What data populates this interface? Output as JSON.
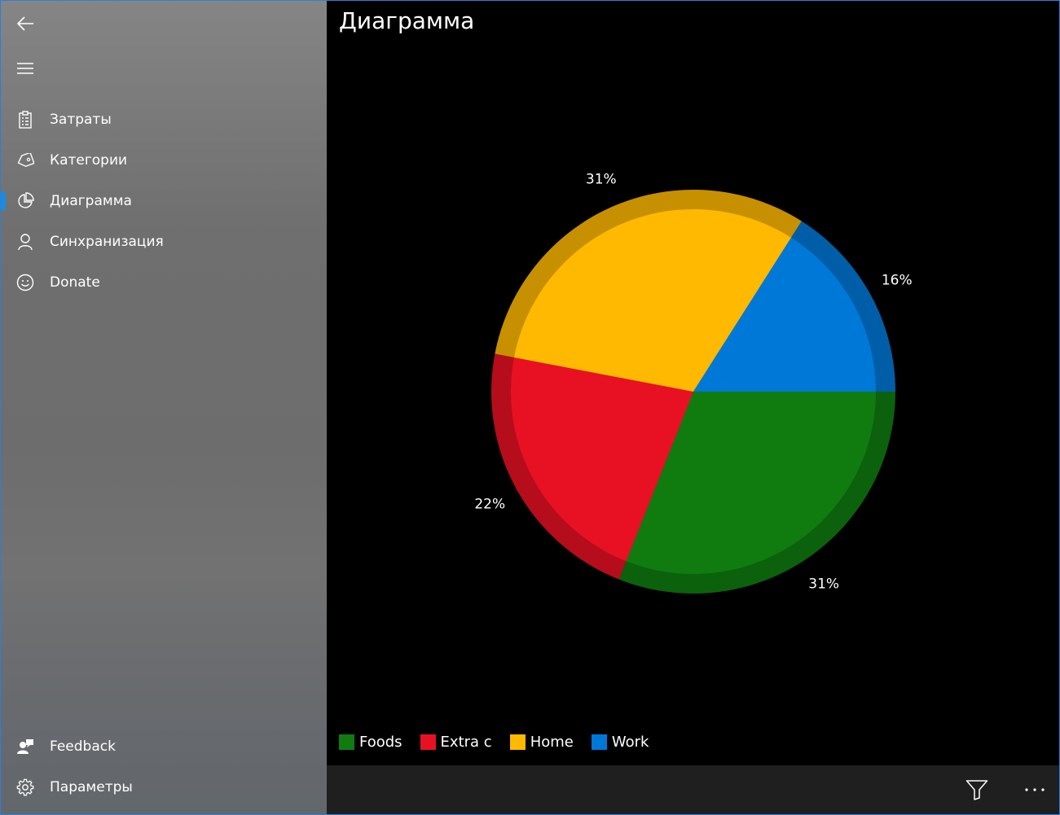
{
  "sidebar": {
    "items": [
      {
        "label": "Затраты",
        "icon": "clipboard-icon"
      },
      {
        "label": "Категории",
        "icon": "tag-icon"
      },
      {
        "label": "Диаграмма",
        "icon": "pie-chart-icon",
        "selected": true
      },
      {
        "label": "Синхранизация",
        "icon": "person-icon"
      },
      {
        "label": "Donate",
        "icon": "smiley-icon"
      }
    ],
    "footer": [
      {
        "label": "Feedback",
        "icon": "feedback-icon"
      },
      {
        "label": "Параметры",
        "icon": "gear-icon"
      }
    ]
  },
  "page": {
    "title": "Диаграмма"
  },
  "chart_data": {
    "type": "pie",
    "categories": [
      "Foods",
      "Extra c",
      "Home",
      "Work"
    ],
    "values": [
      31,
      22,
      31,
      16
    ],
    "slice_labels": [
      "31%",
      "22%",
      "31%",
      "16%"
    ],
    "colors": [
      "#107c10",
      "#e81123",
      "#ffb900",
      "#0078d7"
    ],
    "legend": {
      "placement": "bottom-left"
    }
  },
  "commands": {
    "filter_icon": "filter-icon",
    "more_icon": "more-icon"
  },
  "colors": {
    "accent": "#1d8ae0",
    "command_bar": "#1f1f1f"
  }
}
